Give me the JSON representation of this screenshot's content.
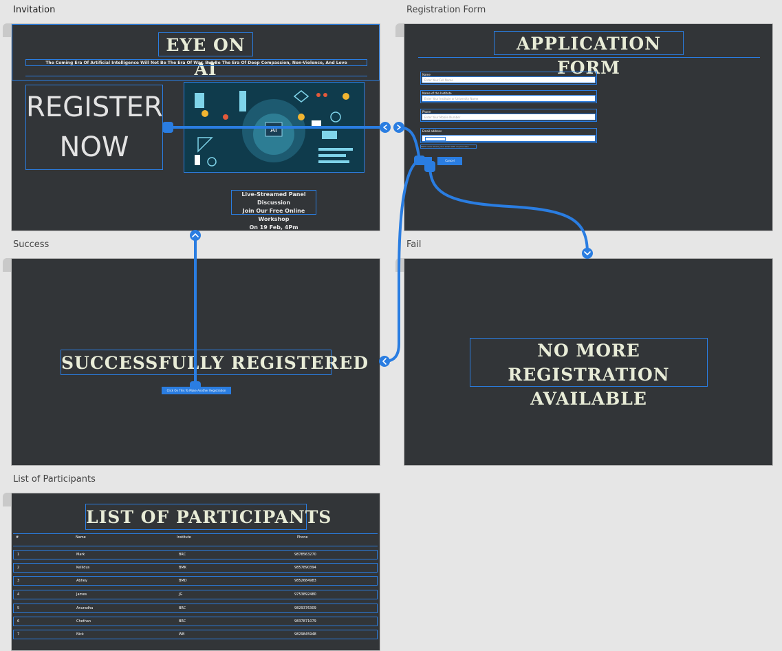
{
  "frames": {
    "invitation": {
      "label": "Invitation",
      "title": "EYE ON AI",
      "tagline": "The Coming Era Of Artificial Intelligence Will Not Be The Era Of War, But Be The Era Of Deep Compassion, Non-Violence, And Love",
      "register_line1": "REGISTER",
      "register_line2": "NOW",
      "ai_chip": "AI",
      "event_line1": "Live-Streamed Panel Discussion",
      "event_line2": "Join Our Free Online Workshop",
      "event_line3": "On 19 Feb, 4Pm"
    },
    "registration": {
      "label": "Registration Form",
      "title": "APPLICATION FORM",
      "fields": [
        {
          "label": "Name",
          "placeholder": "Enter Your Full Name"
        },
        {
          "label": "Name of the Institute",
          "placeholder": "Enter Your Institute or University Name"
        },
        {
          "label": "Phone",
          "placeholder": "Enter Your Mobile Number"
        },
        {
          "label": "Email address",
          "placeholder": ""
        }
      ],
      "email_help": "We'll never share your email with anyone else.",
      "cancel_label": "Cancel"
    },
    "success": {
      "label": "Success",
      "title": "SUCCESSFULLY REGISTERED",
      "button_label": "Click On This To Make Another Registration"
    },
    "fail": {
      "label": "Fail",
      "title_line1": "NO MORE REGISTRATION",
      "title_line2": "AVAILABLE"
    },
    "participants": {
      "label": "List of Participants",
      "title": "LIST OF PARTICIPANTS",
      "columns": [
        "#",
        "Name",
        "Institute",
        "Phone"
      ],
      "rows": [
        [
          "1",
          "Mark",
          "BRC",
          "9878563270"
        ],
        [
          "2",
          "Kellidus",
          "BMK",
          "9857890394"
        ],
        [
          "3",
          "Abhey",
          "BMD",
          "9852684983"
        ],
        [
          "4",
          "James",
          "JG",
          "9753892480"
        ],
        [
          "5",
          "Anuradha",
          "BRC",
          "9829376309"
        ],
        [
          "6",
          "Chethan",
          "BRC",
          "9837871079"
        ],
        [
          "7",
          "Nick",
          "WB",
          "9829845948"
        ]
      ]
    }
  },
  "colors": {
    "canvas": "#e6e6e6",
    "frame_bg": "#323538",
    "accent": "#2a7de1",
    "title_text": "#e8ecd7"
  }
}
